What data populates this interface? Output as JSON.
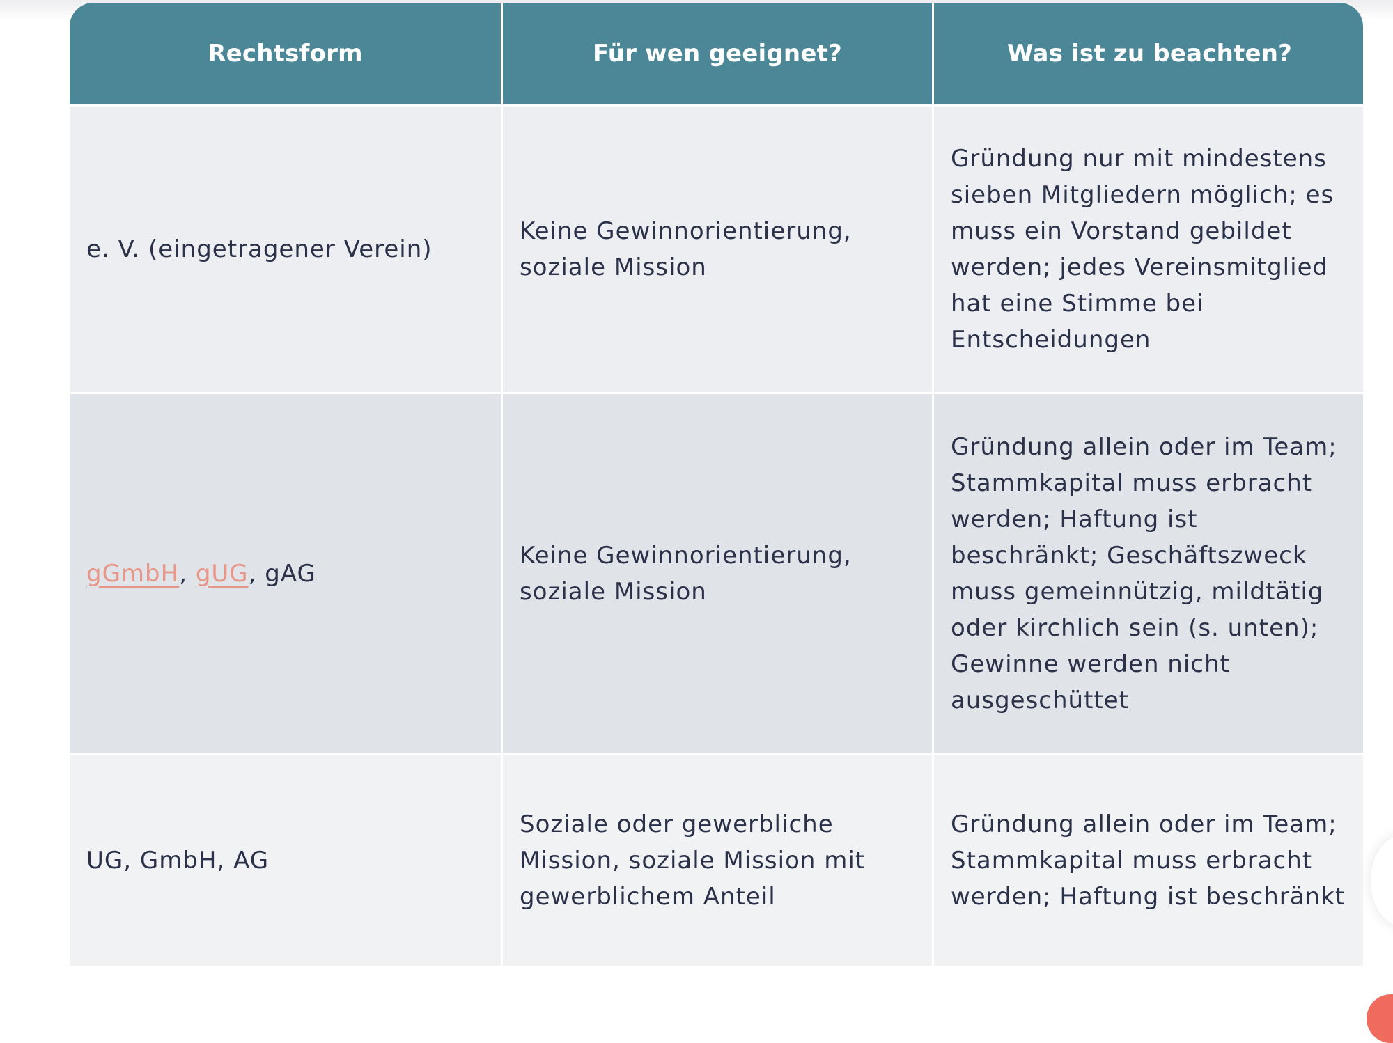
{
  "table": {
    "headers": [
      "Rechtsform",
      "Für wen geeignet?",
      "Was ist zu beachten?"
    ],
    "rows": [
      {
        "rechtsform": "e. V. (eingetragener Verein)",
        "fuer_wen": "Keine Gewinnorientierung, soziale Mission",
        "beachten": "Gründung nur mit mindestens sieben Mitgliedern möglich; es muss ein Vorstand gebildet werden; jedes Vereinsmitglied hat eine Stimme bei Entscheidungen"
      },
      {
        "rechtsform_parts": {
          "link_1": "gGmbH",
          "sep_1": ", ",
          "link_2": "gUG",
          "rest": ", gAG"
        },
        "fuer_wen": "Keine Gewinnorientierung, soziale Mission",
        "beachten": "Gründung allein oder im Team; Stammkapital muss erbracht werden; Haftung ist beschränkt; Geschäftszweck muss gemeinnützig, mildtätig oder kirchlich sein (s. unten); Gewinne werden nicht ausgeschüttet"
      },
      {
        "rechtsform": "UG, GmbH, AG",
        "fuer_wen": "Soziale oder gewerbliche Mission, soziale Mission mit gewerblichem Anteil",
        "beachten": "Gründung allein oder im Team; Stammkapital muss erbracht werden; Haftung ist beschränkt"
      }
    ]
  },
  "colors": {
    "header_bg": "#4c8797",
    "link": "#e8968a",
    "text": "#2a3148",
    "accent": "#ef6b5e"
  }
}
